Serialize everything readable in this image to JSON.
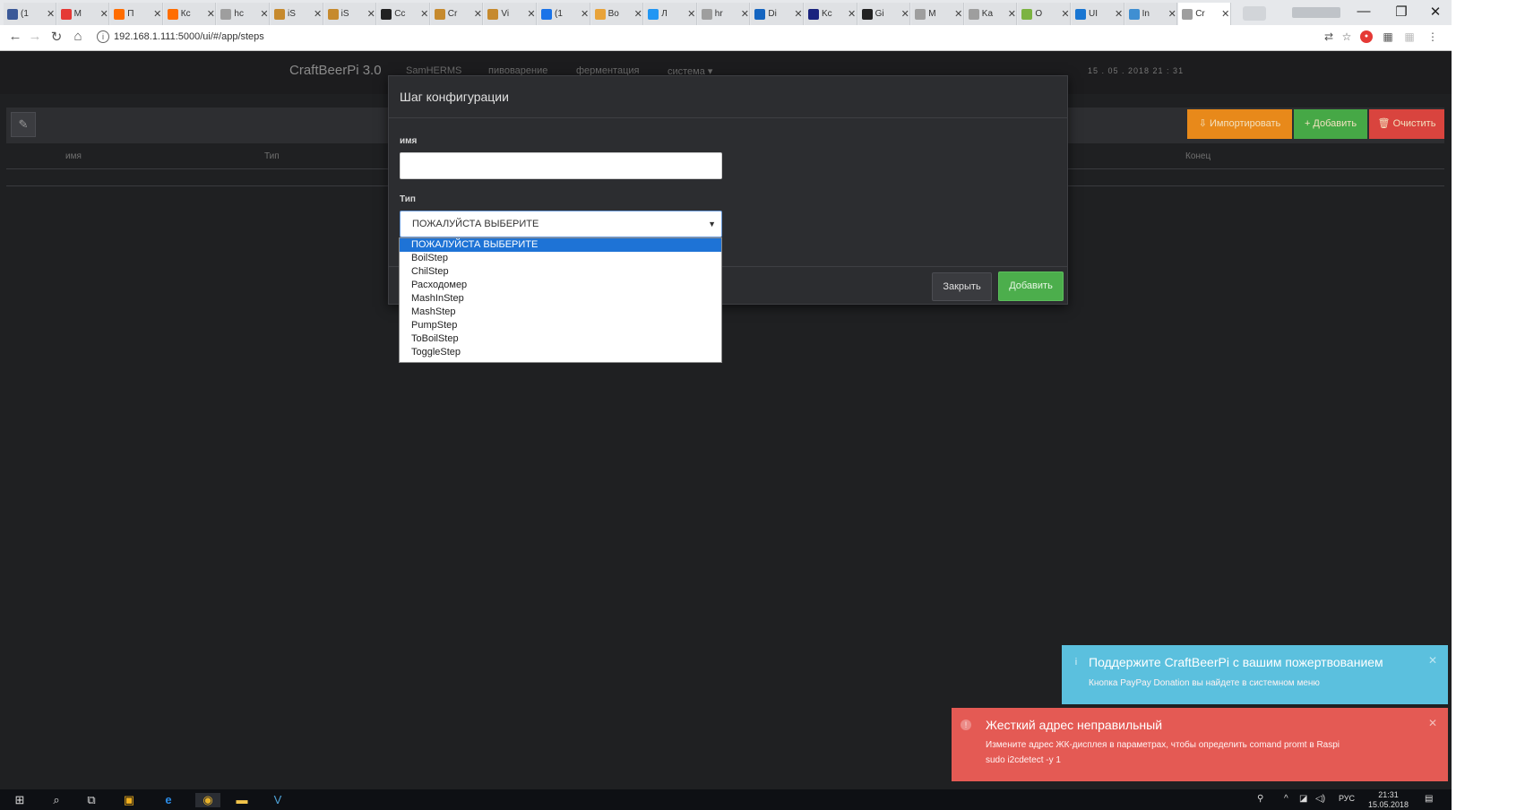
{
  "browser": {
    "tabs": [
      {
        "title": "(1",
        "color": "#3b5998"
      },
      {
        "title": "M",
        "color": "#e53935"
      },
      {
        "title": "П",
        "color": "#ff6d00"
      },
      {
        "title": "Кс",
        "color": "#ff6d00"
      },
      {
        "title": "hc",
        "color": "#9e9e9e"
      },
      {
        "title": "iS",
        "color": "#c68a2e"
      },
      {
        "title": "iS",
        "color": "#c68a2e"
      },
      {
        "title": "Cc",
        "color": "#222222"
      },
      {
        "title": "Cr",
        "color": "#c68a2e"
      },
      {
        "title": "Vi",
        "color": "#c68a2e"
      },
      {
        "title": "(1",
        "color": "#1a73e8"
      },
      {
        "title": "Bo",
        "color": "#e8a33a"
      },
      {
        "title": "Л",
        "color": "#2196f3"
      },
      {
        "title": "hr",
        "color": "#9e9e9e"
      },
      {
        "title": "Di",
        "color": "#1565c0"
      },
      {
        "title": "Kc",
        "color": "#1a237e"
      },
      {
        "title": "Gi",
        "color": "#222222"
      },
      {
        "title": "M",
        "color": "#9e9e9e"
      },
      {
        "title": "Ka",
        "color": "#9e9e9e"
      },
      {
        "title": "O",
        "color": "#7cb342"
      },
      {
        "title": "UI",
        "color": "#1976d2"
      },
      {
        "title": "In",
        "color": "#3f8fd2"
      },
      {
        "title": "Cr",
        "color": "#9e9e9e"
      }
    ],
    "tab_close_glyph": "✕",
    "window_controls": {
      "minimize": "—",
      "restore": "❐",
      "close": "✕"
    },
    "url": "192.168.1.111:5000/ui/#/app/steps"
  },
  "app": {
    "brand": "CraftBeerPi 3.0",
    "nav": [
      {
        "label": "SamHERMS"
      },
      {
        "label": "пивоварение"
      },
      {
        "label": "ферментация"
      },
      {
        "label": "система ▾"
      }
    ],
    "datetime": "15 . 05 . 2018 21 : 31",
    "toolbar": {
      "import_label": "⇩ Импортировать",
      "add_label": "+ Добавить",
      "clear_label": "🗑 Очистить",
      "colors": {
        "import": "#e8891a",
        "add": "#46a846",
        "clear": "#d9443e"
      }
    },
    "table_headers": {
      "name": "имя",
      "type": "Тип",
      "end": "Конец"
    }
  },
  "modal": {
    "title": "Шаг конфигурации",
    "name_label": "имя",
    "name_value": "",
    "type_label": "Тип",
    "type_selected": "ПОЖАЛУЙСТА ВЫБЕРИТЕ",
    "type_options": [
      "ПОЖАЛУЙСТА ВЫБЕРИТЕ",
      "BoilStep",
      "ChilStep",
      "Расходомер",
      "MashInStep",
      "MashStep",
      "PumpStep",
      "ToBoilStep",
      "ToggleStep"
    ],
    "close_label": "Закрыть",
    "add_label": "Добавить"
  },
  "notifications": {
    "info": {
      "title": "Поддержите CraftBeerPi с вашим пожертвованием",
      "message": "Кнопка PayPay Donation вы найдете в системном меню"
    },
    "error": {
      "title": "Жесткий адрес неправильный",
      "message": "Измените адрес ЖК-дисплея в параметрах, чтобы определить comand promt в Raspi",
      "message2": "sudo i2cdetect -y 1"
    }
  },
  "taskbar": {
    "lang": "РУС",
    "time": "21:31",
    "date": "15.05.2018"
  }
}
